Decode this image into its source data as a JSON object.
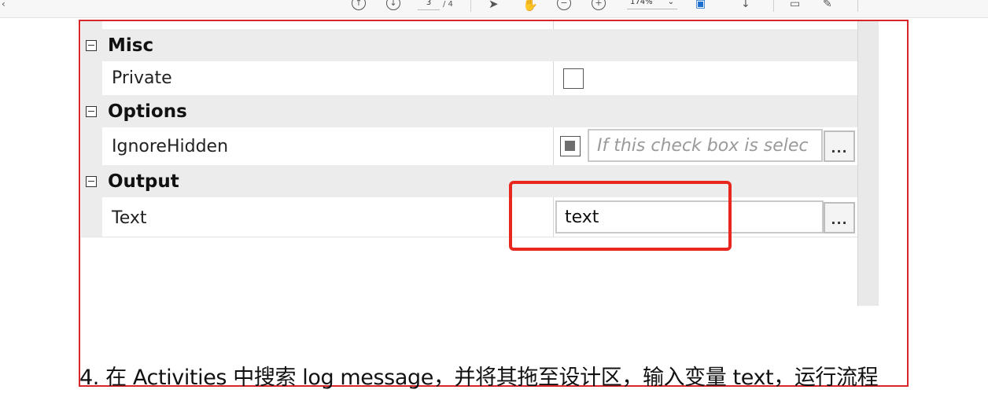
{
  "toolbar": {
    "page_current": "3",
    "page_total": "/ 4",
    "zoom": "174%",
    "icons": [
      "back-icon",
      "page-up-icon",
      "page-down-icon",
      "select-cursor-icon",
      "hand-tool-icon",
      "zoom-out-icon",
      "zoom-in-icon",
      "fit-page-icon",
      "scroll-icon",
      "comment-icon",
      "highlight-icon"
    ]
  },
  "property_grid": {
    "categories": [
      {
        "label": "Misc",
        "properties": [
          {
            "name": "Private",
            "control": "checkbox",
            "checked": false
          }
        ]
      },
      {
        "label": "Options",
        "properties": [
          {
            "name": "IgnoreHidden",
            "control": "checkbox",
            "checked": true,
            "placeholder": "If this check box is selec"
          }
        ]
      },
      {
        "label": "Output",
        "properties": [
          {
            "name": "Text",
            "value": "text"
          }
        ]
      }
    ],
    "ellipsis_label": "..."
  },
  "instruction": {
    "text": "4.  在 Activities 中搜索  log message，并将其拖至设计区，输入变量 text，运行流程"
  },
  "colors": {
    "frame": "#d9262b",
    "annotation": "#e8281f",
    "category_bg": "#ececec"
  }
}
